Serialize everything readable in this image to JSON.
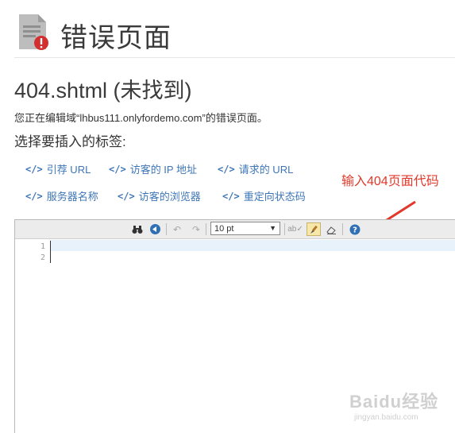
{
  "header": {
    "title": "错误页面",
    "icon": "error-document-icon"
  },
  "subtitle": "404.shtml (未找到)",
  "description": "您正在编辑域“lhbus111.onlyfordemo.com”的错误页面。",
  "choose_label": "选择要插入的标签:",
  "tags": [
    {
      "code": "</>",
      "label": "引荐 URL"
    },
    {
      "code": "</>",
      "label": "访客的 IP 地址"
    },
    {
      "code": "</>",
      "label": "请求的 URL"
    },
    {
      "code": "</>",
      "label": "服务器名称"
    },
    {
      "code": "</>",
      "label": "访客的浏览器"
    },
    {
      "code": "</>",
      "label": "重定向状态码"
    }
  ],
  "annotation": "输入404页面代码",
  "editor": {
    "font_size": "10pt",
    "font_size_display": "10 pt",
    "line_numbers": [
      "1",
      "2"
    ],
    "content": ""
  },
  "watermark": {
    "main": "Baidu经验",
    "sub": "jingyan.baidu.com"
  },
  "colors": {
    "link": "#3d76b7",
    "annotation": "#e0392b",
    "error_badge": "#d32f2f"
  }
}
